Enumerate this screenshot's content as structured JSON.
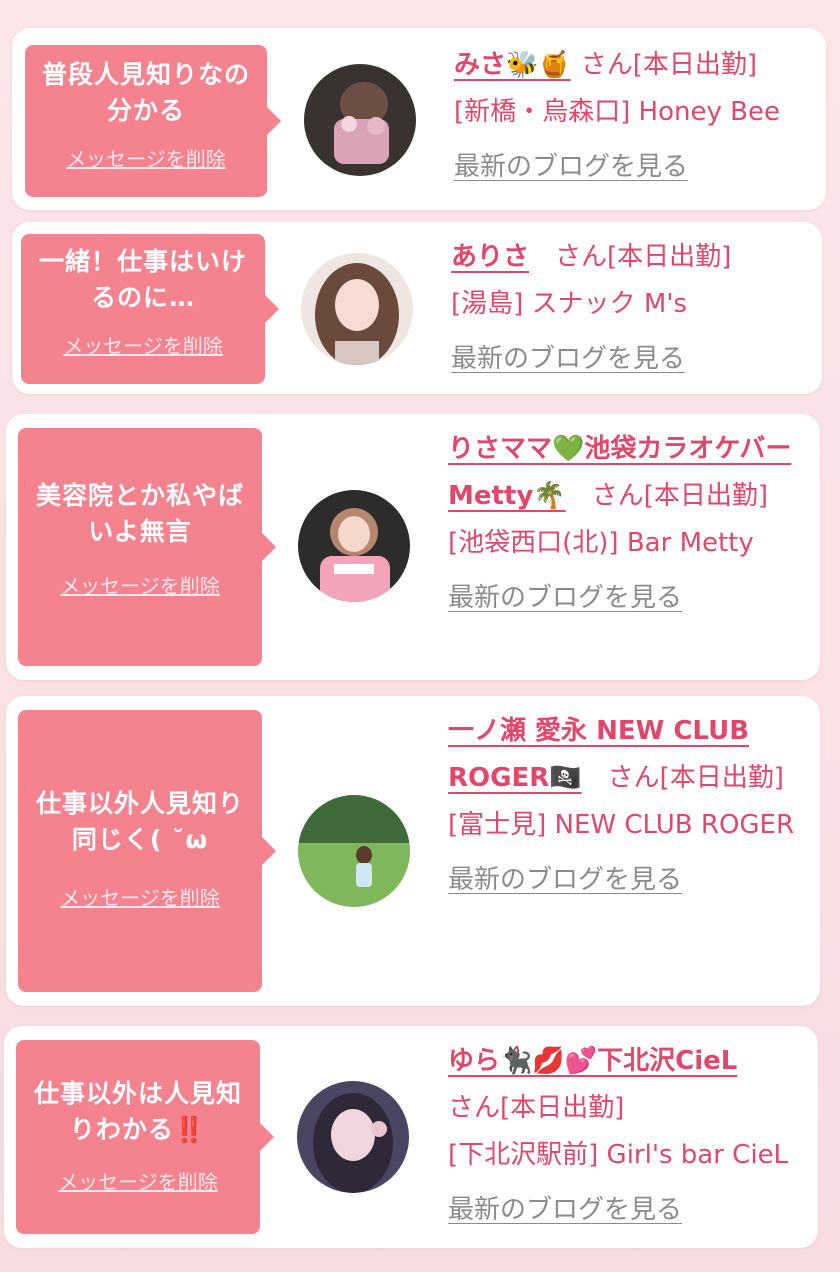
{
  "accent": "#e0476a",
  "bubble_color": "#f4838f",
  "cards": [
    {
      "message": "普段人見知りなの分かる",
      "delete_label": "メッセージを削除",
      "name": "みさ🐝🍯",
      "san_status": "さん[本日出勤]",
      "shop": "[新橋・烏森口] Honey Bee",
      "blog_label": "最新のブログを見る"
    },
    {
      "message": "一緒！仕事はいけるのに…",
      "delete_label": "メッセージを削除",
      "name": "ありさ",
      "san_status": "さん[本日出勤]",
      "shop": "[湯島] スナック M's",
      "blog_label": "最新のブログを見る"
    },
    {
      "message": "美容院とか私やばいよ無言",
      "delete_label": "メッセージを削除",
      "name": "りさママ💚池袋カラオケバーMetty🌴",
      "san_status": "さん[本日出勤]",
      "shop": "[池袋西口(北)] Bar Metty",
      "blog_label": "最新のブログを見る"
    },
    {
      "message": "仕事以外人見知り同じく( ˘ω",
      "delete_label": "メッセージを削除",
      "name": "一ノ瀬 愛永 NEW CLUB ROGER🏴‍☠️",
      "san_status": "さん[本日出勤]",
      "shop": "[富士見] NEW CLUB ROGER",
      "blog_label": "最新のブログを見る"
    },
    {
      "message": "仕事以外は人見知りわかる‼️",
      "delete_label": "メッセージを削除",
      "name": "ゆら🐈‍⬛💋💕下北沢CieL",
      "san_status": "さん[本日出勤]",
      "shop": "[下北沢駅前] Girl's bar CieL",
      "blog_label": "最新のブログを見る"
    }
  ]
}
